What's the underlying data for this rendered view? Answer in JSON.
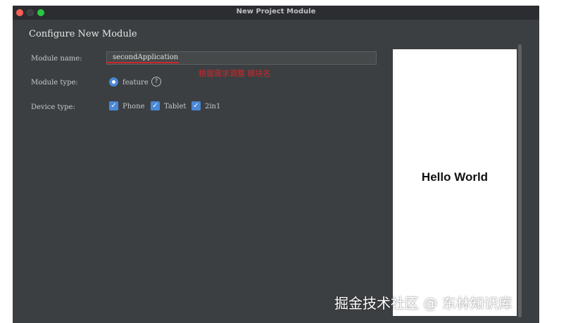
{
  "window": {
    "title": "New Project Module"
  },
  "page": {
    "heading": "Configure New Module"
  },
  "form": {
    "module_name_label": "Module name:",
    "module_name_value": "secondApplication",
    "module_type_label": "Module type:",
    "module_type_option": "feature",
    "help_symbol": "?",
    "device_type_label": "Device type:",
    "devices": [
      {
        "label": "Phone",
        "checked": true
      },
      {
        "label": "Tablet",
        "checked": true
      },
      {
        "label": "2in1",
        "checked": true
      }
    ]
  },
  "annotation": {
    "text": "根据需求调整 模块名"
  },
  "preview": {
    "text": "Hello World"
  },
  "watermark": {
    "text": "掘金技术社区 @ 东林知识库"
  },
  "colors": {
    "window_bg": "#3c3f41",
    "titlebar_bg": "#2b2d30",
    "accent": "#4b88d6",
    "annotation_red": "#d0262b"
  },
  "icons": {
    "close": "close-traffic-light-icon",
    "minimize": "minimize-traffic-light-icon",
    "maximize": "maximize-traffic-light-icon",
    "help": "help-icon",
    "check": "checkmark-icon"
  }
}
